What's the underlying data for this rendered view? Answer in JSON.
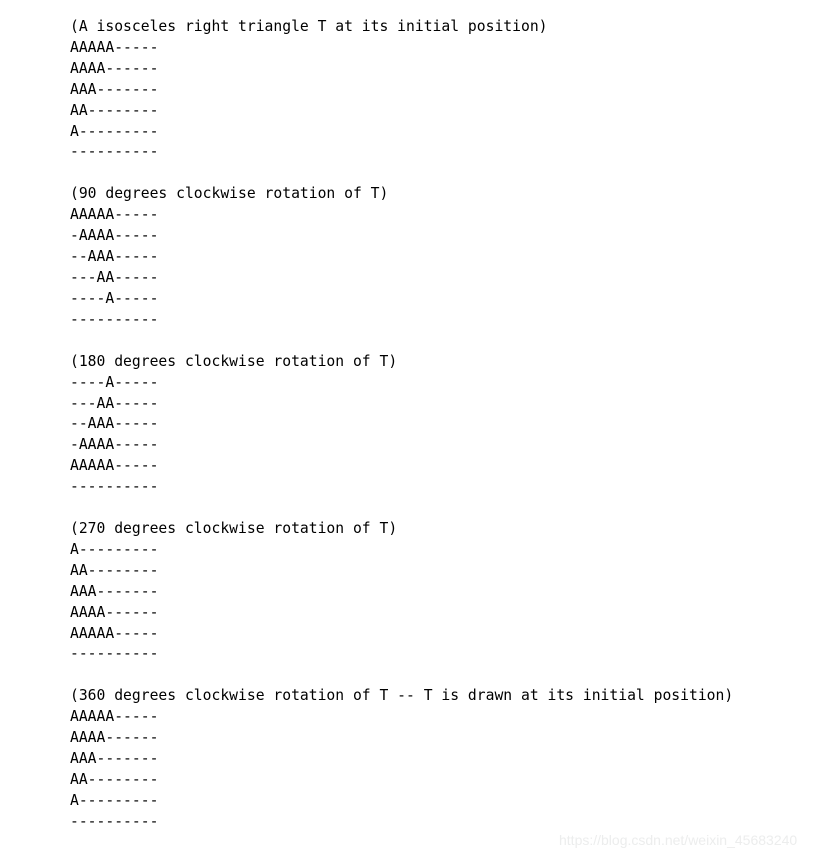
{
  "page": {
    "background_color": "#ffffff",
    "text_color": "#000000",
    "title": "ASCII Triangle Rotation Output"
  },
  "blocks": [
    {
      "id": "initial",
      "caption": "(A isosceles right triangle T at its initial position)",
      "rows": [
        "AAAAA-----",
        "AAAA------",
        "AAA-------",
        "AA--------",
        "A---------",
        "----------"
      ]
    },
    {
      "id": "rotate-90",
      "caption": "(90 degrees clockwise rotation of T)",
      "rows": [
        "AAAAA-----",
        "-AAAA-----",
        "--AAA-----",
        "---AA-----",
        "----A-----",
        "----------"
      ]
    },
    {
      "id": "rotate-180",
      "caption": "(180 degrees clockwise rotation of T)",
      "rows": [
        "----A-----",
        "---AA-----",
        "--AAA-----",
        "-AAAA-----",
        "AAAAA-----",
        "----------"
      ]
    },
    {
      "id": "rotate-270",
      "caption": "(270 degrees clockwise rotation of T)",
      "rows": [
        "A---------",
        "AA--------",
        "AAA-------",
        "AAAA------",
        "AAAAA-----",
        "----------"
      ]
    },
    {
      "id": "rotate-360",
      "caption": "(360 degrees clockwise rotation of T -- T is drawn at its initial position)",
      "rows": [
        "AAAAA-----",
        "AAAA------",
        "AAA-------",
        "AA--------",
        "A---------",
        "----------"
      ]
    }
  ],
  "watermark": {
    "text": "https://blog.csdn.net/weixin_45683240",
    "color": "#eceded"
  }
}
